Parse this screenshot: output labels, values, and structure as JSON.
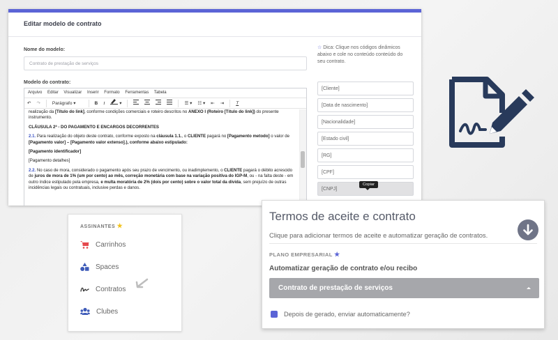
{
  "editor": {
    "title": "Editar modelo de contrato",
    "name_label": "Nome do modelo:",
    "name_value": "Contrato de prestação de serviços",
    "model_label": "Modelo do contrato:",
    "menu": [
      "Arquivo",
      "Editar",
      "Visualizar",
      "Inserir",
      "Formato",
      "Ferramentas",
      "Tabela"
    ],
    "format_select": "Parágrafo",
    "tip": "Dica: Clique nos códigos dinâmicos abaixo e cole no conteúdo conteúdo do seu contrato.",
    "codes": [
      "[Cliente]",
      "[Data de nascimento]",
      "[Nacionalidade]",
      "[Estado civil]",
      "[RG]",
      "[CPF]",
      "[CNPJ]"
    ],
    "tooltip": "Copiar",
    "content": {
      "p1_a": "realização da ",
      "p1_b": "[Título do link]",
      "p1_c": ", conforme condições comerciais e roteiro descritos no ",
      "p1_d": "ANEXO I (Roteiro [Título do link])",
      "p1_e": " do presente instrumento.",
      "clause2": "CLÁUSULA 2ª - DO PAGAMENTO E ENCARGOS DECORRENTES",
      "p21_num": "2.1.",
      "p21_a": " Para realização do objeto deste contrato, conforme exposto na ",
      "p21_b": "cláusula 1.1.",
      "p21_c": ", o ",
      "p21_d": "CLIENTE",
      "p21_e": " pagará no ",
      "p21_f": "[Pagamento metodo]",
      "p21_g": " o valor de ",
      "p21_h": "[Pagamento valor] – [Pagamento valor extenso].), conforme abaixo estipulado:",
      "pay_id": "[Pagamento identificador]",
      "pay_det": "[Pagamento detalhes]",
      "p22_num": "2.2.",
      "p22_a": " No caso de mora, considerado o pagamento após seu prazo de vencimento, ou inadimplemento, o ",
      "p22_b": "CLIENTE",
      "p22_c": " pagará o débito acrescido de ",
      "p22_d": "juros de mora de 1% (um por cento) ao mês, correção monetária com base na variação positiva do IGP-M",
      "p22_e": ", ou - na falta deste - em outro índice estipulado pela empresa, ",
      "p22_f": "e multa moratória de 2% (dois por cento) sobre o valor total da dívida",
      "p22_g": ", sem prejuízo de outras incidências legais ou contratuais, inclusive perdas e danos."
    }
  },
  "sidebar": {
    "heading": "ASSINANTES",
    "items": [
      {
        "label": "Carrinhos",
        "icon": "cart-icon",
        "color": "#e5484d"
      },
      {
        "label": "Spaces",
        "icon": "shapes-icon",
        "color": "#3e5bb8"
      },
      {
        "label": "Contratos",
        "icon": "signature-icon",
        "color": "#333333"
      },
      {
        "label": "Clubes",
        "icon": "users-icon",
        "color": "#3e5bb8"
      }
    ]
  },
  "terms": {
    "title": "Termos de aceite e contrato",
    "subtitle": "Clique para adicionar termos de aceite e automatizar geração de contratos.",
    "plan": "PLANO EMPRESARIAL",
    "auto_label": "Automatizar geração de contrato e/ou recibo",
    "select_value": "Contrato de prestação de serviços",
    "checkbox_label": "Depois de gerado, enviar automaticamente?"
  },
  "colors": {
    "accent": "#5b64d6",
    "icon_navy": "#283a5b",
    "star": "#f2c21b"
  }
}
